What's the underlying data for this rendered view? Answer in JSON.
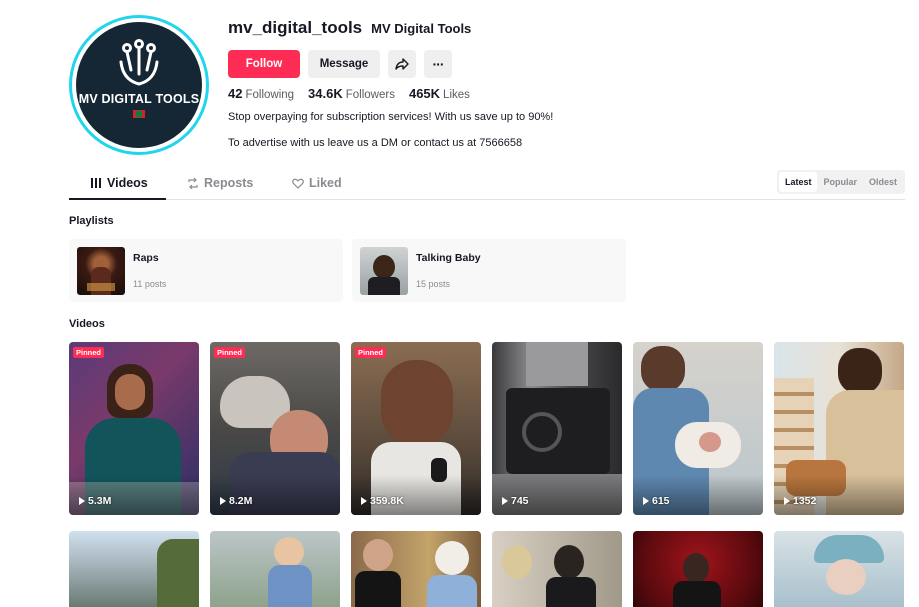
{
  "profile": {
    "username": "mv_digital_tools",
    "nickname": "MV Digital Tools",
    "avatar_text": "MV DIGITAL TOOLS",
    "follow_label": "Follow",
    "message_label": "Message",
    "share_icon": "share-icon",
    "more_icon": "more-icon",
    "more_label": "···",
    "stats": {
      "following_count": "42",
      "following_label": "Following",
      "followers_count": "34.6K",
      "followers_label": "Followers",
      "likes_count": "465K",
      "likes_label": "Likes"
    },
    "bio_line1": "Stop overpaying for subscription services! With us save up to 90%!",
    "bio_line2": "To advertise with us leave us a DM or contact us at 7566658"
  },
  "tabs": [
    {
      "label": "Videos",
      "icon": "grid-icon",
      "active": true
    },
    {
      "label": "Reposts",
      "icon": "repost-icon",
      "active": false
    },
    {
      "label": "Liked",
      "icon": "heart-icon",
      "active": false
    }
  ],
  "sort": {
    "options": [
      "Latest",
      "Popular",
      "Oldest"
    ],
    "selected": "Latest"
  },
  "playlists_title": "Playlists",
  "playlists": [
    {
      "name": "Raps",
      "count": "11 posts"
    },
    {
      "name": "Talking Baby",
      "count": "15 posts"
    }
  ],
  "videos_title": "Videos",
  "videos": [
    {
      "pinned": "Pinned",
      "views": "5.3M"
    },
    {
      "pinned": "Pinned",
      "views": "8.2M"
    },
    {
      "pinned": "Pinned",
      "views": "359.8K"
    },
    {
      "pinned": "",
      "views": "745"
    },
    {
      "pinned": "",
      "views": "615"
    },
    {
      "pinned": "",
      "views": "1352"
    }
  ],
  "colors": {
    "accent": "#fe2c55",
    "ring": "#20d5ec",
    "text": "#161823",
    "muted": "#8a8b91"
  }
}
